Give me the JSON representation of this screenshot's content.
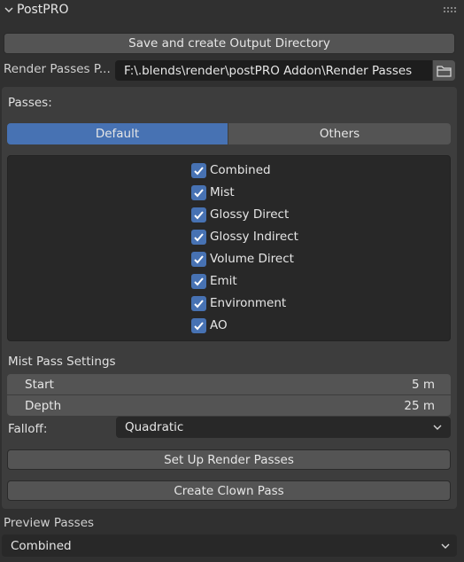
{
  "panel": {
    "title": "PostPRO"
  },
  "buttons": {
    "save_output": "Save and create Output Directory",
    "setup_render_passes": "Set Up Render Passes",
    "create_clown_pass": "Create Clown Pass"
  },
  "render_passes_path": {
    "label": "Render Passes P...",
    "value": "F:\\.blends\\render\\postPRO Addon\\Render Passes"
  },
  "passes": {
    "label": "Passes:",
    "tabs": [
      {
        "label": "Default",
        "active": true
      },
      {
        "label": "Others",
        "active": false
      }
    ],
    "items": [
      {
        "label": "Combined",
        "checked": true
      },
      {
        "label": "Mist",
        "checked": true
      },
      {
        "label": "Glossy Direct",
        "checked": true
      },
      {
        "label": "Glossy Indirect",
        "checked": true
      },
      {
        "label": "Volume Direct",
        "checked": true
      },
      {
        "label": "Emit",
        "checked": true
      },
      {
        "label": "Environment",
        "checked": true
      },
      {
        "label": "AO",
        "checked": true
      }
    ]
  },
  "mist_settings": {
    "label": "Mist Pass Settings",
    "start": {
      "label": "Start",
      "value": "5 m"
    },
    "depth": {
      "label": "Depth",
      "value": "25 m"
    },
    "falloff": {
      "label": "Falloff:",
      "value": "Quadratic"
    }
  },
  "preview": {
    "label": "Preview Passes",
    "value": "Combined"
  },
  "colors": {
    "accent": "#4772b3",
    "panel_bg": "#303030",
    "inner_bg": "#3d3d3d",
    "field_bg": "#282828",
    "button_bg": "#545454"
  }
}
